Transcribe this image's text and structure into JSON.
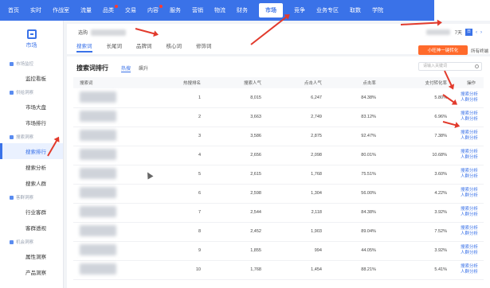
{
  "topnav": {
    "items": [
      "首页",
      "实时",
      "作战室",
      "流量",
      "品类",
      "交易",
      "内容",
      "服务",
      "营销",
      "物流",
      "财务",
      "市场",
      "竞争",
      "业务专区",
      "取数",
      "学院"
    ],
    "active_index": 11,
    "dot_indices": [
      4,
      6
    ]
  },
  "sidebar": {
    "logo_label": "市场",
    "sections": [
      {
        "group": "市场监控",
        "items": [
          "监控看板"
        ]
      },
      {
        "group": "供给洞察",
        "items": [
          "市场大盘",
          "市场排行"
        ]
      },
      {
        "group": "搜索洞察",
        "items": [
          "搜索排行",
          "搜索分析",
          "搜索人群"
        ]
      },
      {
        "group": "客群洞察",
        "items": [
          "行业客群",
          "客群透视"
        ]
      },
      {
        "group": "机会洞察",
        "items": [
          "属性洞察",
          "产品洞察"
        ]
      }
    ],
    "active_item": "搜索排行"
  },
  "header": {
    "crumb_label": "选购",
    "tabs": [
      "搜索词",
      "长尾词",
      "品牌词",
      "核心词",
      "修饰词"
    ],
    "active_tab": 0,
    "date_label": "7天",
    "page_btn": "日",
    "orange_button": "小旺神一键转化",
    "compete_label": "所有终端"
  },
  "panel": {
    "title": "搜索词排行",
    "subtabs": [
      "热搜",
      "飙升"
    ],
    "active_subtab": 0,
    "search_placeholder": "请输入关键词",
    "columns": [
      "搜索词",
      "热搜排名",
      "搜索人气",
      "点击人气",
      "点击率",
      "支付转化率",
      "操作"
    ],
    "rows": [
      {
        "rank": "1",
        "popularity": "8,015",
        "click": "6,247",
        "ctr": "84.38%",
        "conv": "5.80%"
      },
      {
        "rank": "2",
        "popularity": "3,663",
        "click": "2,749",
        "ctr": "83.12%",
        "conv": "6.96%"
      },
      {
        "rank": "3",
        "popularity": "3,586",
        "click": "2,875",
        "ctr": "92.47%",
        "conv": "7.38%"
      },
      {
        "rank": "4",
        "popularity": "2,656",
        "click": "2,098",
        "ctr": "80.01%",
        "conv": "10.68%"
      },
      {
        "rank": "5",
        "popularity": "2,615",
        "click": "1,768",
        "ctr": "75.51%",
        "conv": "3.60%"
      },
      {
        "rank": "6",
        "popularity": "2,598",
        "click": "1,304",
        "ctr": "56.00%",
        "conv": "4.22%"
      },
      {
        "rank": "7",
        "popularity": "2,544",
        "click": "2,118",
        "ctr": "84.38%",
        "conv": "3.92%"
      },
      {
        "rank": "8",
        "popularity": "2,452",
        "click": "1,903",
        "ctr": "89.04%",
        "conv": "7.52%"
      },
      {
        "rank": "9",
        "popularity": "1,855",
        "click": "994",
        "ctr": "44.05%",
        "conv": "3.92%"
      },
      {
        "rank": "10",
        "popularity": "1,768",
        "click": "1,454",
        "ctr": "88.21%",
        "conv": "5.41%"
      }
    ],
    "op_labels": [
      "搜索分析",
      "人群分析"
    ]
  }
}
